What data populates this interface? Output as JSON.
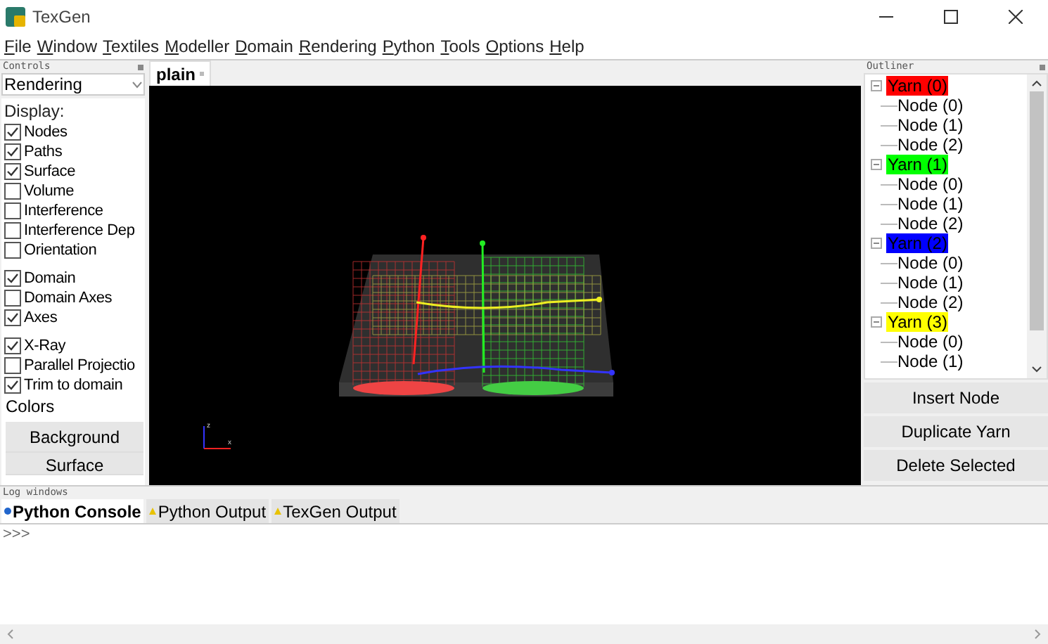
{
  "window": {
    "title": "TexGen"
  },
  "menu": [
    "File",
    "Window",
    "Textiles",
    "Modeller",
    "Domain",
    "Rendering",
    "Python",
    "Tools",
    "Options",
    "Help"
  ],
  "controls": {
    "title": "Controls",
    "mode": "Rendering",
    "display_label": "Display:",
    "groups": [
      [
        {
          "label": "Nodes",
          "checked": true
        },
        {
          "label": "Paths",
          "checked": true
        },
        {
          "label": "Surface",
          "checked": true
        },
        {
          "label": "Volume",
          "checked": false
        },
        {
          "label": "Interference",
          "checked": false
        },
        {
          "label": "Interference Dep",
          "checked": false
        },
        {
          "label": "Orientation",
          "checked": false
        }
      ],
      [
        {
          "label": "Domain",
          "checked": true
        },
        {
          "label": "Domain Axes",
          "checked": false
        },
        {
          "label": "Axes",
          "checked": true
        }
      ],
      [
        {
          "label": "X-Ray",
          "checked": true
        },
        {
          "label": "Parallel Projectio",
          "checked": false
        },
        {
          "label": "Trim to domain",
          "checked": true
        }
      ]
    ],
    "colors_label": "Colors",
    "buttons": [
      "Background",
      "Surface"
    ]
  },
  "viewport": {
    "tab": "plain",
    "axis_labels": [
      "z",
      "x"
    ]
  },
  "outliner": {
    "title": "Outliner",
    "yarns": [
      {
        "label": "Yarn (0)",
        "color": "#ff0000",
        "expanded": true,
        "children": [
          "Node (0)",
          "Node (1)",
          "Node (2)"
        ]
      },
      {
        "label": "Yarn (1)",
        "color": "#00ff00",
        "expanded": true,
        "children": [
          "Node (0)",
          "Node (1)",
          "Node (2)"
        ]
      },
      {
        "label": "Yarn (2)",
        "color": "#0000ff",
        "expanded": true,
        "children": [
          "Node (0)",
          "Node (1)",
          "Node (2)"
        ]
      },
      {
        "label": "Yarn (3)",
        "color": "#ffff00",
        "expanded": true,
        "children": [
          "Node (0)",
          "Node (1)"
        ]
      }
    ],
    "buttons": [
      "Insert Node",
      "Duplicate Yarn",
      "Delete Selected"
    ]
  },
  "log": {
    "title": "Log windows",
    "tabs": [
      {
        "label": "Python Console",
        "selected": true,
        "kind": "console"
      },
      {
        "label": "Python Output",
        "selected": false,
        "kind": "warning"
      },
      {
        "label": "TexGen Output",
        "selected": false,
        "kind": "warning"
      }
    ],
    "prompt": ">>>"
  }
}
